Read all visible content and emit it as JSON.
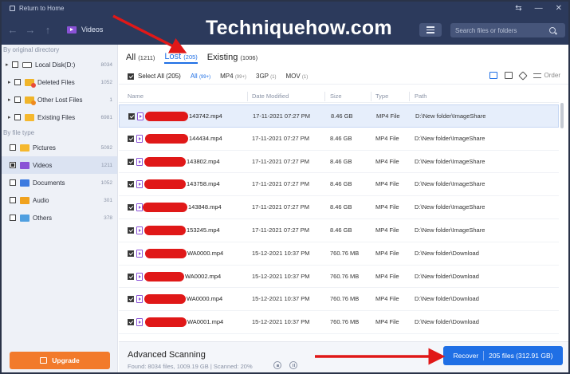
{
  "window": {
    "back_label": "Return to Home",
    "controls": [
      "⇆",
      "—",
      "✕"
    ]
  },
  "toolbar": {
    "breadcrumb": "Videos",
    "watermark": "Techniquehow.com",
    "search_placeholder": "Search files or folders"
  },
  "sidebar": {
    "section_directory": "By original directory",
    "directory": [
      {
        "label": "Local Disk(D:)",
        "count": "8034",
        "caret": "▸"
      },
      {
        "label": "Deleted Files",
        "count": "1052",
        "caret": "▸"
      },
      {
        "label": "Other Lost Files",
        "count": "1",
        "caret": "▸"
      },
      {
        "label": "Existing Files",
        "count": "6981",
        "caret": "▸"
      }
    ],
    "section_type": "By file type",
    "types": [
      {
        "label": "Pictures",
        "count": "5092"
      },
      {
        "label": "Videos",
        "count": "1211"
      },
      {
        "label": "Documents",
        "count": "1052"
      },
      {
        "label": "Audio",
        "count": "301"
      },
      {
        "label": "Others",
        "count": "378"
      }
    ],
    "upgrade_label": "Upgrade"
  },
  "tabs": [
    {
      "label": "All",
      "count": "(1211)"
    },
    {
      "label": "Lost",
      "count": "(205)"
    },
    {
      "label": "Existing",
      "count": "(1006)"
    }
  ],
  "filters": {
    "select_all": "Select All (205)",
    "types": [
      {
        "label": "All",
        "count": "(99+)"
      },
      {
        "label": "MP4",
        "count": "(99+)"
      },
      {
        "label": "3GP",
        "count": "(1)"
      },
      {
        "label": "MOV",
        "count": "(1)"
      }
    ],
    "order_label": "Order"
  },
  "table": {
    "columns": [
      "Name",
      "Date Modified",
      "Size",
      "Type",
      "Path"
    ],
    "rows": [
      {
        "name": "143742.mp4",
        "date": "17-11-2021 07:27 PM",
        "size": "8.46 GB",
        "type": "MP4 File",
        "path": "D:\\New folder\\ImageShare"
      },
      {
        "name": "144434.mp4",
        "date": "17-11-2021 07:27 PM",
        "size": "8.46 GB",
        "type": "MP4 File",
        "path": "D:\\New folder\\ImageShare"
      },
      {
        "name": "143802.mp4",
        "date": "17-11-2021 07:27 PM",
        "size": "8.46 GB",
        "type": "MP4 File",
        "path": "D:\\New folder\\ImageShare"
      },
      {
        "name": "143758.mp4",
        "date": "17-11-2021 07:27 PM",
        "size": "8.46 GB",
        "type": "MP4 File",
        "path": "D:\\New folder\\ImageShare"
      },
      {
        "name": "143848.mp4",
        "date": "17-11-2021 07:27 PM",
        "size": "8.46 GB",
        "type": "MP4 File",
        "path": "D:\\New folder\\ImageShare"
      },
      {
        "name": "153245.mp4",
        "date": "17-11-2021 07:27 PM",
        "size": "8.46 GB",
        "type": "MP4 File",
        "path": "D:\\New folder\\ImageShare"
      },
      {
        "name": "WA0000.mp4",
        "date": "15-12-2021 10:37 PM",
        "size": "760.76 MB",
        "type": "MP4 File",
        "path": "D:\\New folder\\Download"
      },
      {
        "name": "WA0002.mp4",
        "date": "15-12-2021 10:37 PM",
        "size": "760.76 MB",
        "type": "MP4 File",
        "path": "D:\\New folder\\Download"
      },
      {
        "name": "WA0000.mp4",
        "date": "15-12-2021 10:37 PM",
        "size": "760.76 MB",
        "type": "MP4 File",
        "path": "D:\\New folder\\Download"
      },
      {
        "name": "WA0001.mp4",
        "date": "15-12-2021 10:37 PM",
        "size": "760.76 MB",
        "type": "MP4 File",
        "path": "D:\\New folder\\Download"
      }
    ]
  },
  "footer": {
    "title": "Advanced Scanning",
    "status": "Found: 8034 files, 1009.19 GB   |   Scanned: 20%",
    "recover_label": "Recover",
    "recover_summary": "205 files (312.91 GB)"
  },
  "colors": {
    "accent": "#1f6fe5",
    "header_bg": "#2c3a5c",
    "upgrade": "#f27a2b",
    "annotation_red": "#e01818"
  }
}
